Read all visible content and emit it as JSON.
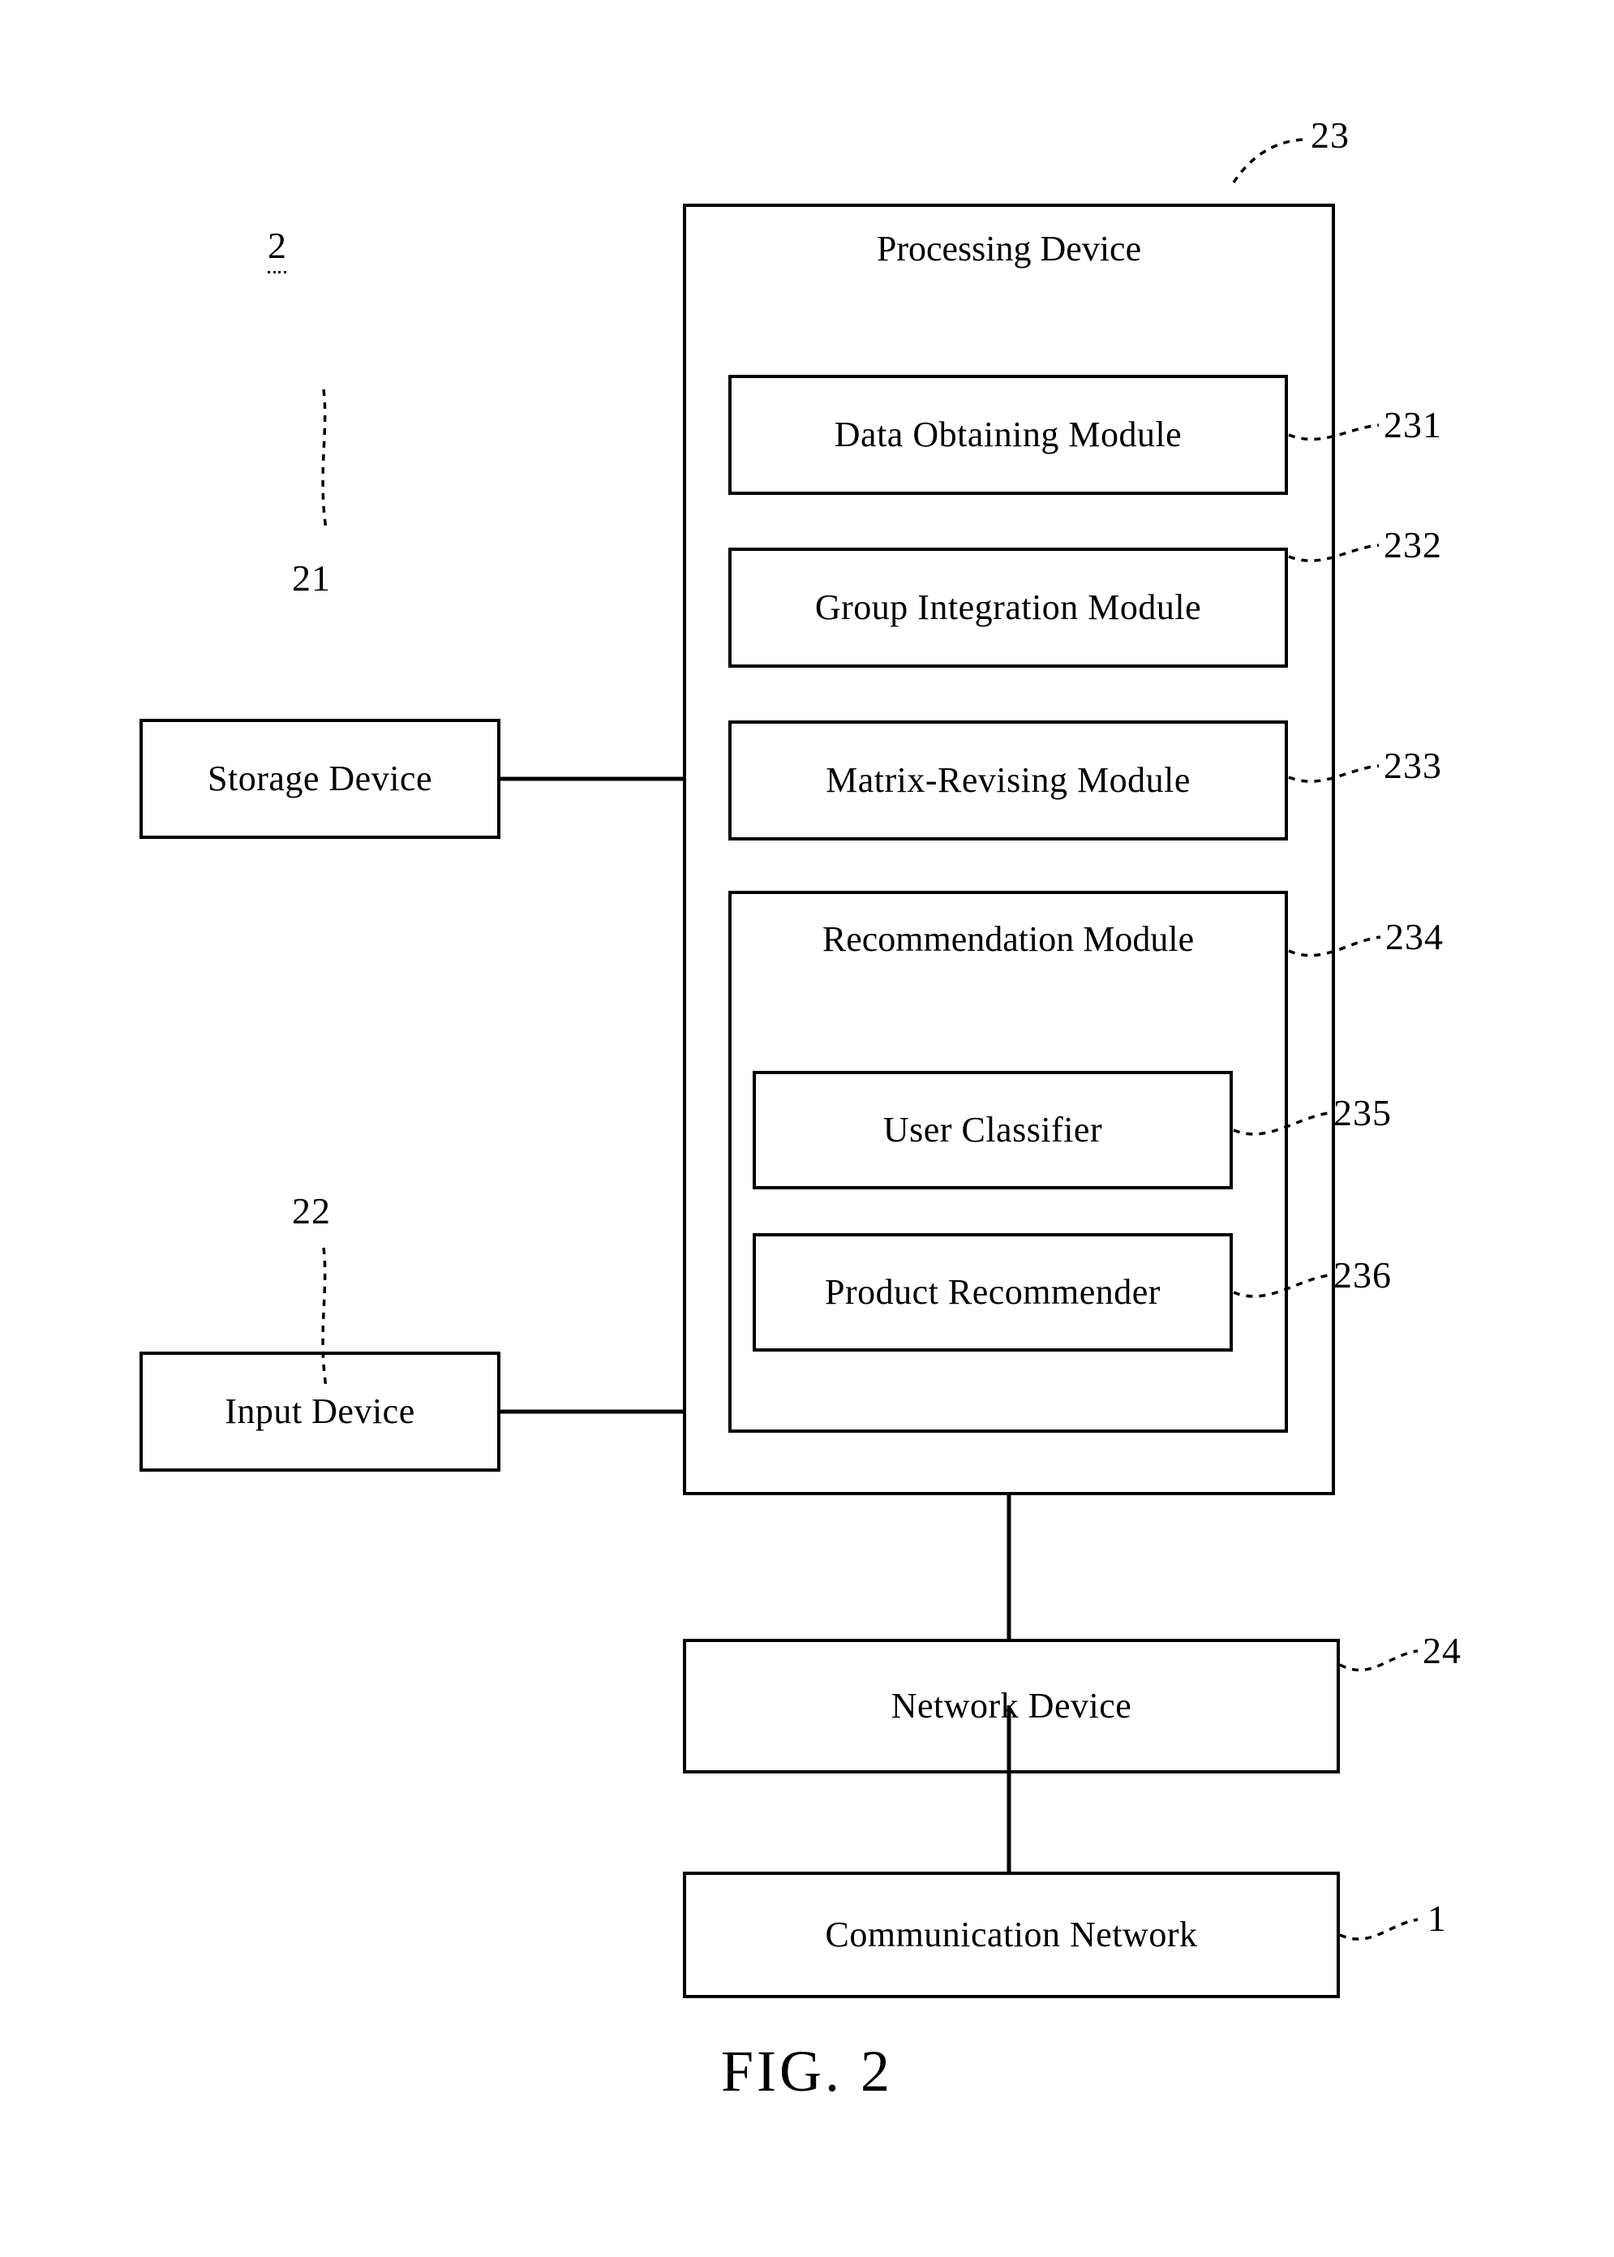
{
  "figure": {
    "caption": "FIG. 2",
    "system_ref": "2"
  },
  "processing_device": {
    "title": "Processing Device",
    "ref": "23",
    "modules": [
      {
        "label": "Data Obtaining Module",
        "ref": "231"
      },
      {
        "label": "Group Integration Module",
        "ref": "232"
      },
      {
        "label": "Matrix-Revising Module",
        "ref": "233"
      }
    ],
    "recommendation_module": {
      "label": "Recommendation Module",
      "ref": "234",
      "submodules": [
        {
          "label": "User Classifier",
          "ref": "235"
        },
        {
          "label": "Product Recommender",
          "ref": "236"
        }
      ]
    }
  },
  "peripherals": [
    {
      "label": "Storage Device",
      "ref": "21"
    },
    {
      "label": "Input  Device",
      "ref": "22"
    }
  ],
  "network": {
    "device_label": "Network Device",
    "device_ref": "24",
    "communication_label": "Communication Network",
    "communication_ref": "1"
  },
  "colors": {
    "stroke": "#000000",
    "background": "#ffffff"
  }
}
